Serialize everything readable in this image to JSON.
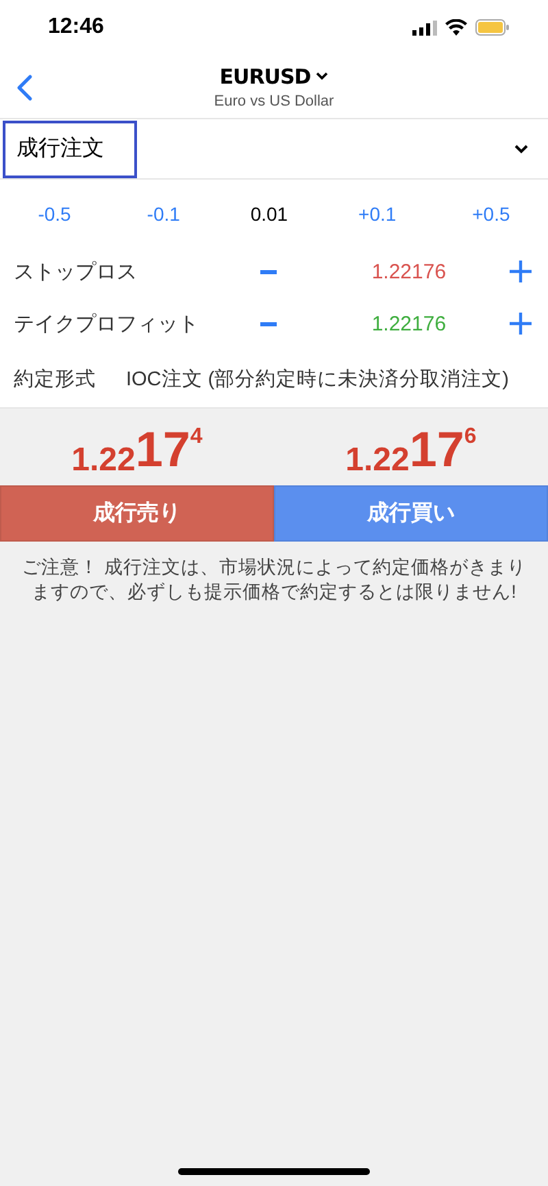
{
  "status_bar": {
    "time": "12:46"
  },
  "header": {
    "symbol": "EURUSD",
    "subtitle": "Euro vs US Dollar"
  },
  "order_type": {
    "value": "成行注文",
    "focused": true
  },
  "steps": [
    {
      "label": "-0.5",
      "kind": "step"
    },
    {
      "label": "-0.1",
      "kind": "step"
    },
    {
      "label": "0.01",
      "kind": "value"
    },
    {
      "label": "+0.1",
      "kind": "step"
    },
    {
      "label": "+0.5",
      "kind": "step"
    }
  ],
  "levels": [
    {
      "label": "ストップロス",
      "value": "1.22176",
      "color": "#d9534f"
    },
    {
      "label": "テイクプロフィット",
      "value": "1.22176",
      "color": "#3fae3f"
    }
  ],
  "execution": {
    "label": "約定形式",
    "value": "IOC注文 (部分約定時に未決済分取消注文)"
  },
  "prices": [
    {
      "lead": "1.22",
      "big": "17",
      "sup": "4"
    },
    {
      "lead": "1.22",
      "big": "17",
      "sup": "6"
    }
  ],
  "actions": [
    {
      "label": "成行売り",
      "kind": "sell"
    },
    {
      "label": "成行買い",
      "kind": "buy"
    }
  ],
  "notice": "ご注意！ 成行注文は、市場状況によって約定価格がきまりますので、必ずしも提示価格で約定するとは限りません!"
}
